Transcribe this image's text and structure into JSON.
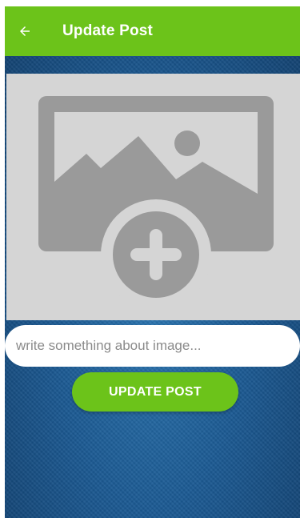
{
  "app_bar": {
    "title": "Update Post",
    "back_icon": "arrow-left-icon",
    "color": "#6cc31a"
  },
  "image_picker": {
    "icon": "add-photo-icon",
    "background": "#d5d5d5",
    "icon_color": "#9a9a9a"
  },
  "caption": {
    "placeholder": "write something about image...",
    "value": ""
  },
  "update_button": {
    "label": "UPDATE POST",
    "color": "#6cc31a"
  },
  "background_color": "#1c5a93"
}
